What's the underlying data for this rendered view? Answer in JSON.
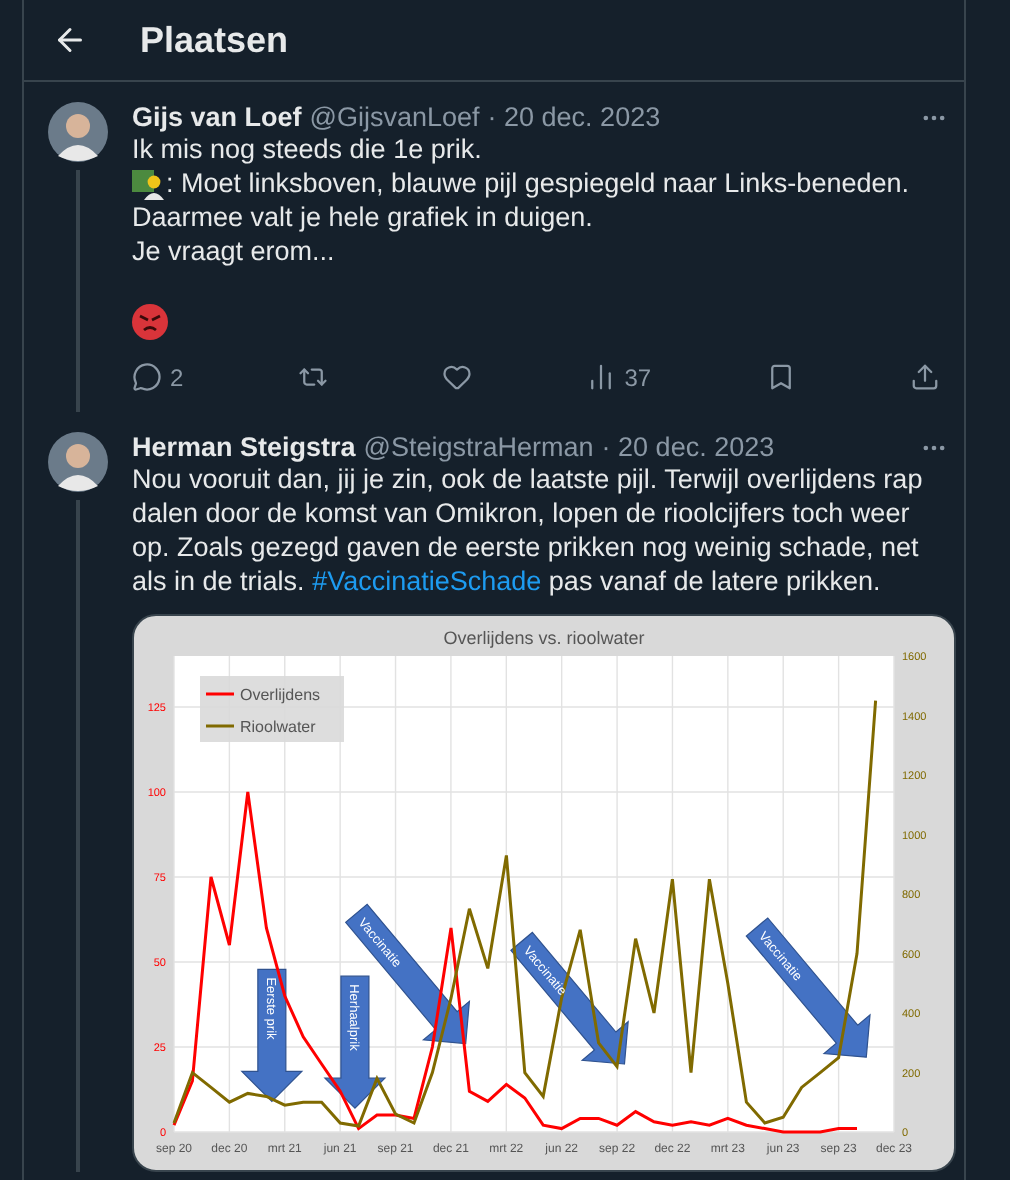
{
  "header": {
    "title": "Plaatsen"
  },
  "tweets": [
    {
      "author": {
        "name": "Gijs van Loef",
        "handle": "@GijsvanLoef",
        "date": "· 20 dec. 2023"
      },
      "body": [
        {
          "kind": "text",
          "text": "Ik mis nog steeds die 1e prik."
        },
        {
          "kind": "teacher-emoji-text",
          "text": ": Moet linksboven, blauwe pijl gespiegeld naar Links-beneden."
        },
        {
          "kind": "text",
          "text": "Daarmee valt je hele grafiek in duigen."
        },
        {
          "kind": "text",
          "text": "Je vraagt erom..."
        },
        {
          "kind": "angry-emoji"
        }
      ],
      "actions": [
        {
          "kind": "reply",
          "count": "2"
        },
        {
          "kind": "repost"
        },
        {
          "kind": "like"
        },
        {
          "kind": "views",
          "count": "37"
        },
        {
          "kind": "bookmark"
        },
        {
          "kind": "share"
        }
      ]
    },
    {
      "author": {
        "name": "Herman Steigstra",
        "handle": "@SteigstraHerman",
        "date": "· 20 dec. 2023"
      },
      "body": [
        {
          "kind": "paragraph",
          "parts": [
            {
              "kind": "text",
              "text": "Nou vooruit dan, jij je zin, ook de laatste pijl. Terwijl overlijdens rap dalen door de komst van Omikron, lopen de rioolcijfers toch weer op. Zoals gezegd gaven de eerste prikken nog weinig schade, net als in de trials."
            },
            {
              "kind": "hashtag",
              "text": "#VaccinatieSchade"
            },
            {
              "kind": "text",
              "text": "pas vanaf de latere prikken."
            }
          ]
        }
      ],
      "media": {
        "chart_data": {
          "type": "line",
          "title": "Overlijdens vs. rioolwater",
          "categories": [
            "sep 20",
            null,
            null,
            "dec 20",
            null,
            null,
            "mrt 21",
            null,
            null,
            "jun 21",
            null,
            null,
            "sep 21",
            null,
            null,
            "dec 21",
            null,
            null,
            "mrt 22",
            null,
            null,
            "jun 22",
            null,
            null,
            "sep 22",
            null,
            null,
            "dec 22",
            null,
            null,
            "mrt 23",
            null,
            null,
            "jun 23",
            null,
            null,
            "sep 23",
            null,
            null,
            "dec 23"
          ],
          "series": [
            {
              "name": "Overlijdens",
              "color": "#ff0000",
              "values": [
                2,
                15,
                75,
                55,
                100,
                60,
                40,
                28,
                20,
                12,
                1,
                5,
                5,
                4,
                25,
                60,
                12,
                9,
                14,
                10,
                2,
                1,
                4,
                4,
                2,
                6,
                3,
                2,
                3,
                2,
                4,
                2,
                1,
                0,
                0,
                0,
                1,
                1,
                null,
                null
              ]
            },
            {
              "name": "Rioolwater",
              "color": "#806a00",
              "axis": "y2",
              "values": [
                30,
                200,
                150,
                100,
                130,
                120,
                90,
                100,
                100,
                30,
                20,
                180,
                60,
                30,
                200,
                450,
                750,
                550,
                930,
                200,
                120,
                450,
                680,
                300,
                220,
                650,
                400,
                850,
                200,
                850,
                500,
                100,
                30,
                50,
                150,
                200,
                250,
                600,
                1450,
                null
              ]
            }
          ],
          "ylim": [
            0,
            140
          ],
          "yticks": [
            0,
            25,
            50,
            75,
            100,
            125
          ],
          "grid": true,
          "legend": true,
          "y2lim": [
            0,
            1600
          ],
          "y2ticks": [
            0,
            200,
            400,
            600,
            800,
            1000,
            1200,
            1400,
            1600
          ],
          "annotations": [
            "Eerste prik",
            "Herhaalprik",
            "Vaccinatie",
            "Vaccinatie",
            "Vaccinatie"
          ]
        }
      }
    }
  ]
}
